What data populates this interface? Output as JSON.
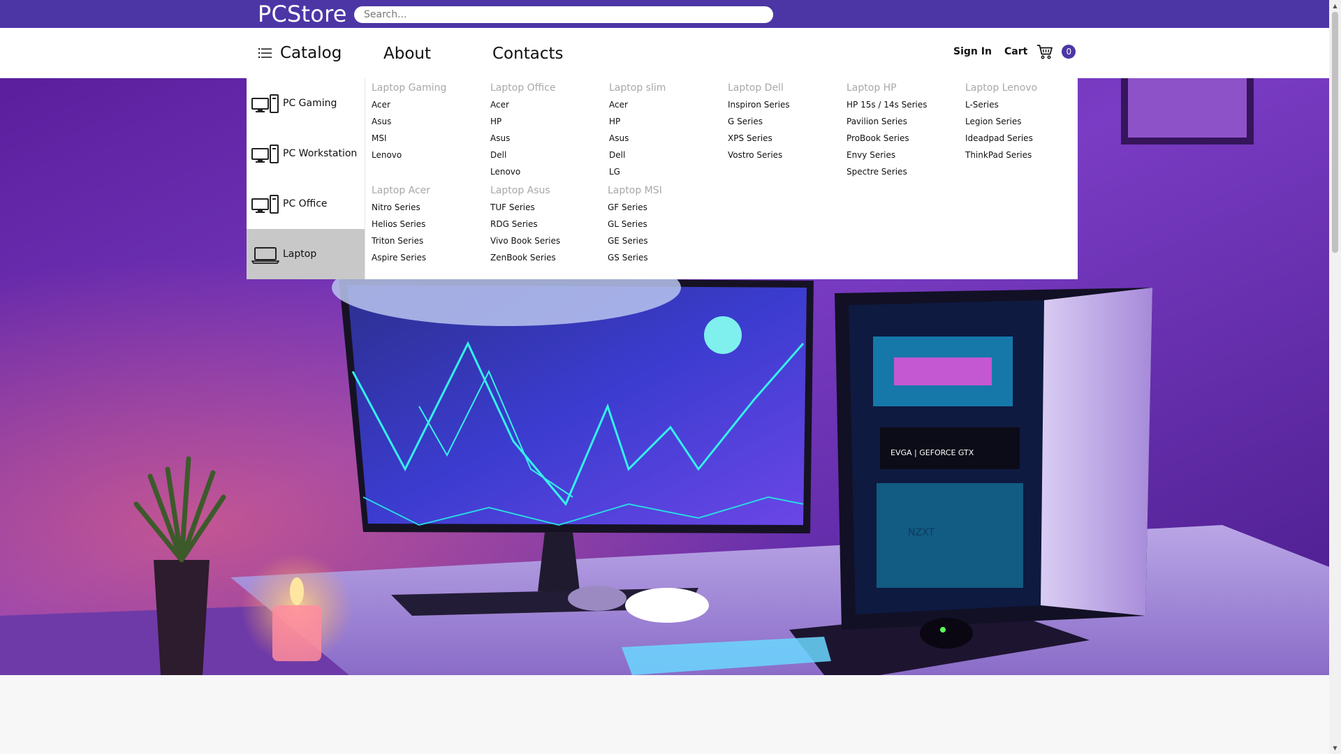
{
  "header": {
    "logo": "PCStore",
    "search_placeholder": "Search..."
  },
  "nav": {
    "catalog_label": "Catalog",
    "about_label": "About",
    "contacts_label": "Contacts",
    "signin_label": "Sign In",
    "cart_label": "Cart",
    "cart_count": "0"
  },
  "catalog_menu": {
    "categories": [
      {
        "label": "PC Gaming",
        "icon": "desktop-tower-icon",
        "active": false
      },
      {
        "label": "PC Workstation",
        "icon": "desktop-tower-icon",
        "active": false
      },
      {
        "label": "PC Office",
        "icon": "desktop-tower-icon",
        "active": false
      },
      {
        "label": "Laptop",
        "icon": "laptop-icon",
        "active": true
      }
    ],
    "groups": [
      {
        "title": "Laptop Gaming",
        "items": [
          "Acer",
          "Asus",
          "MSI",
          "Lenovo"
        ]
      },
      {
        "title": "Laptop Office",
        "items": [
          "Acer",
          "HP",
          "Asus",
          "Dell",
          "Lenovo"
        ]
      },
      {
        "title": "Laptop slim",
        "items": [
          "Acer",
          "HP",
          "Asus",
          "Dell",
          "LG"
        ]
      },
      {
        "title": "Laptop Dell",
        "items": [
          "Inspiron Series",
          "G Series",
          "XPS Series",
          "Vostro Series"
        ]
      },
      {
        "title": "Laptop HP",
        "items": [
          "HP 15s / 14s Series",
          "Pavilion Series",
          "ProBook Series",
          "Envy Series",
          "Spectre Series"
        ]
      },
      {
        "title": "Laptop Lenovo",
        "items": [
          "L-Series",
          "Legion Series",
          "Ideadpad Series",
          "ThinkPad Series"
        ]
      },
      {
        "title": "Laptop Acer",
        "items": [
          "Nitro Series",
          "Helios Series",
          "Triton Series",
          "Aspire Series"
        ]
      },
      {
        "title": "Laptop Asus",
        "items": [
          "TUF Series",
          "RDG Series",
          "Vivo Book Series",
          "ZenBook Series"
        ]
      },
      {
        "title": "Laptop MSI",
        "items": [
          "GF Series",
          "GL Series",
          "GE Series",
          "GS Series"
        ]
      }
    ]
  },
  "hero_image": {
    "monitor_text": "",
    "case_label_1": "NZXT",
    "case_label_2": "EVGA | GEFORCE GTX",
    "case_logo": "NZXT"
  },
  "colors": {
    "brand": "#4c36a6",
    "active_category_bg": "#c8c8c8",
    "group_title": "#a8a8a8"
  }
}
